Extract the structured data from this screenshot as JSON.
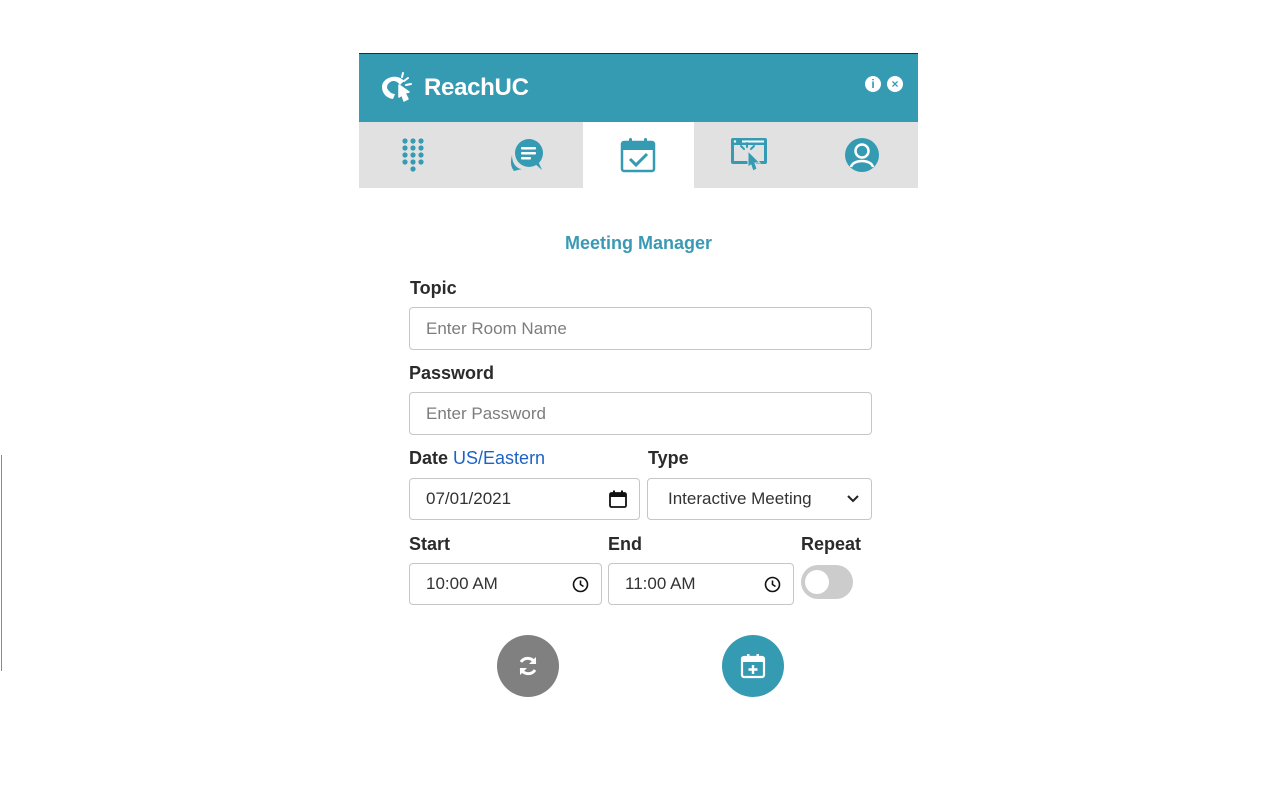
{
  "app": {
    "name": "ReachUC"
  },
  "header": {
    "info_icon": "info-circle-icon",
    "close_icon": "close-circle-icon"
  },
  "tabs": [
    {
      "id": "dialpad",
      "icon": "dialpad-icon",
      "active": false
    },
    {
      "id": "chat",
      "icon": "chat-icon",
      "active": false
    },
    {
      "id": "meetings",
      "icon": "calendar-check-icon",
      "active": true
    },
    {
      "id": "web",
      "icon": "web-click-icon",
      "active": false
    },
    {
      "id": "profile",
      "icon": "user-icon",
      "active": false
    }
  ],
  "form": {
    "title": "Meeting Manager",
    "topic": {
      "label": "Topic",
      "placeholder": "Enter Room Name",
      "value": ""
    },
    "password": {
      "label": "Password",
      "placeholder": "Enter Password",
      "value": ""
    },
    "date": {
      "label": "Date",
      "timezone": "US/Eastern",
      "value": "07/01/2021"
    },
    "type": {
      "label": "Type",
      "value": "Interactive Meeting"
    },
    "start": {
      "label": "Start",
      "value": "10:00 AM"
    },
    "end": {
      "label": "End",
      "value": "11:00 AM"
    },
    "repeat": {
      "label": "Repeat",
      "on": false
    }
  },
  "actions": {
    "reset_icon": "refresh-icon",
    "create_icon": "calendar-plus-icon"
  },
  "colors": {
    "brand": "#359bb3",
    "tab_bar": "#e1e1e1",
    "reset_button": "#808080",
    "timezone_link": "#1d63c4"
  }
}
